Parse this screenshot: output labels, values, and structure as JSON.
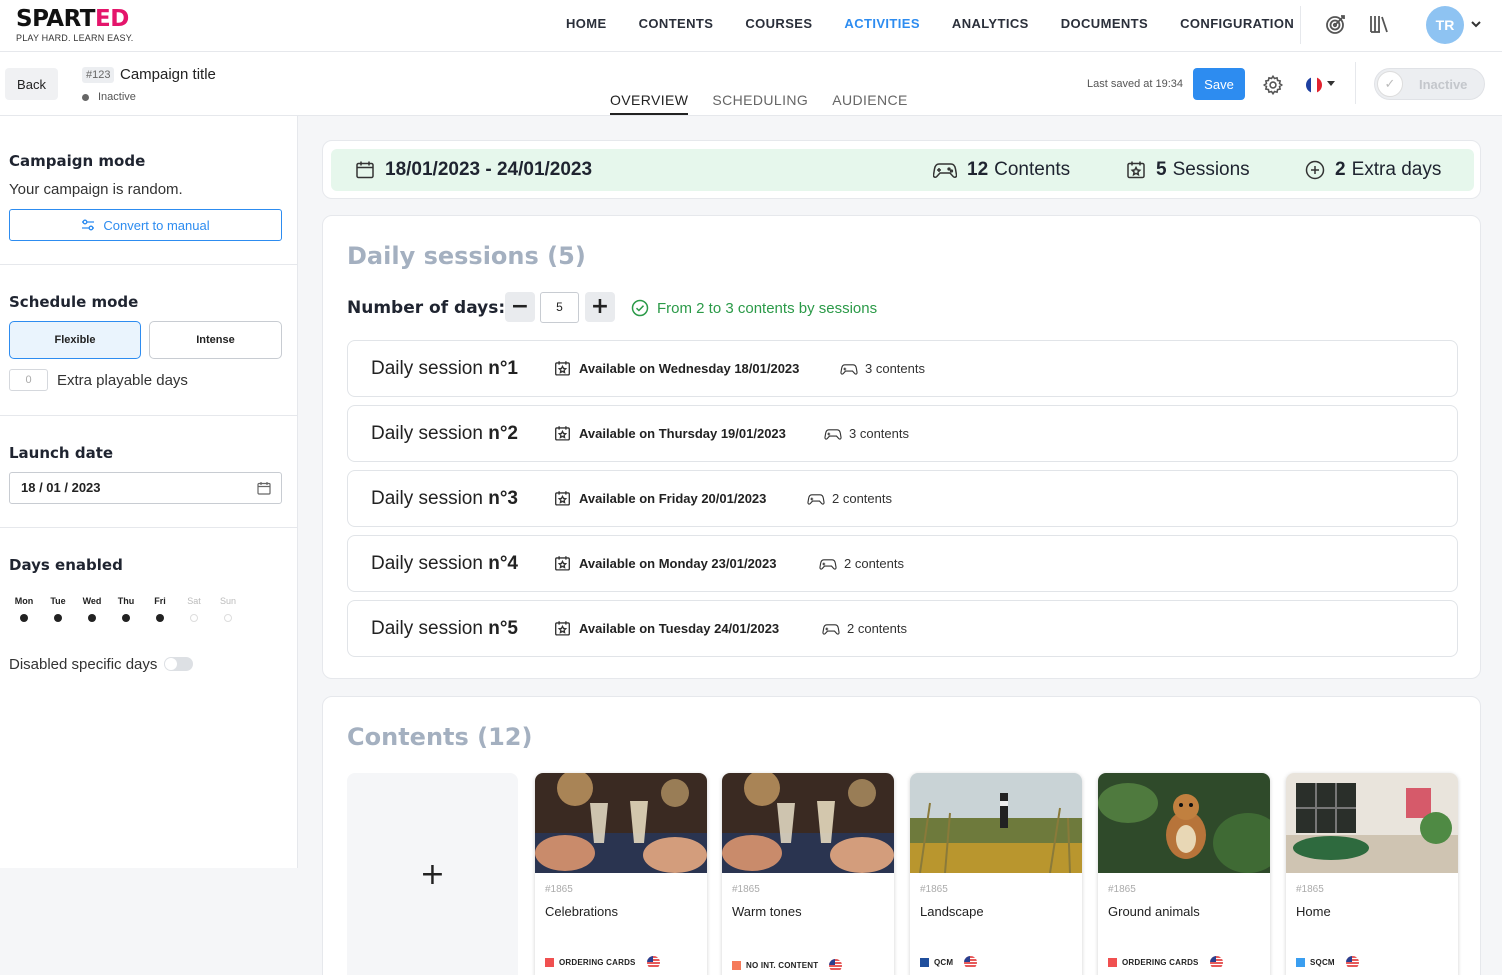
{
  "brand": {
    "name_main": "SPART",
    "name_accent": "ED",
    "tagline": "PLAY HARD. LEARN EASY.",
    "accent_color": "#e4156b"
  },
  "nav": {
    "items": [
      "HOME",
      "CONTENTS",
      "COURSES",
      "ACTIVITIES",
      "ANALYTICS",
      "DOCUMENTS",
      "CONFIGURATION"
    ],
    "active": "ACTIVITIES",
    "icons": [
      "target-icon",
      "library-icon"
    ],
    "avatar_initials": "TR"
  },
  "header": {
    "back_label": "Back",
    "campaign_id": "#123",
    "campaign_title": "Campaign title",
    "status": "Inactive",
    "tabs": [
      "OVERVIEW",
      "SCHEDULING",
      "AUDIENCE"
    ],
    "active_tab": "OVERVIEW",
    "last_saved": "Last saved at 19:34",
    "save_label": "Save",
    "toggle_label": "Inactive",
    "language_flag": "fr"
  },
  "sidebar": {
    "campaign_mode": {
      "title": "Campaign mode",
      "text": "Your campaign is random.",
      "button": "Convert to manual"
    },
    "schedule_mode": {
      "title": "Schedule mode",
      "options": [
        "Flexible",
        "Intense"
      ],
      "selected": "Flexible",
      "extra_days_value": "0",
      "extra_days_label": "Extra playable days"
    },
    "launch_date": {
      "title": "Launch date",
      "value": "18 / 01 / 2023"
    },
    "days_enabled": {
      "title": "Days enabled",
      "days": [
        {
          "name": "Mon",
          "enabled": true
        },
        {
          "name": "Tue",
          "enabled": true
        },
        {
          "name": "Wed",
          "enabled": true
        },
        {
          "name": "Thu",
          "enabled": true
        },
        {
          "name": "Fri",
          "enabled": true
        },
        {
          "name": "Sat",
          "enabled": false
        },
        {
          "name": "Sun",
          "enabled": false
        }
      ],
      "disabled_specific_label": "Disabled specific days"
    }
  },
  "summary": {
    "date_range": "18/01/2023 - 24/01/2023",
    "contents_count": "12",
    "contents_label": "Contents",
    "sessions_count": "5",
    "sessions_label": "Sessions",
    "extra_count": "2",
    "extra_label": "Extra days",
    "bg_color": "#e6f7ec"
  },
  "daily_sessions": {
    "title": "Daily sessions (5)",
    "number_of_days_label": "Number of days:",
    "number_of_days": "5",
    "minus": "−",
    "plus": "+",
    "range_note": "From 2 to 3 contents by sessions",
    "sessions": [
      {
        "name": "Daily session ",
        "num": "n°1",
        "available": "Available on Wednesday 18/01/2023",
        "contents": "3 contents"
      },
      {
        "name": "Daily session ",
        "num": "n°2",
        "available": "Available on Thursday 19/01/2023",
        "contents": "3 contents"
      },
      {
        "name": "Daily session ",
        "num": "n°3",
        "available": "Available on Friday 20/01/2023",
        "contents": "2 contents"
      },
      {
        "name": "Daily session ",
        "num": "n°4",
        "available": "Available on Monday 23/01/2023",
        "contents": "2 contents"
      },
      {
        "name": "Daily session ",
        "num": "n°5",
        "available": "Available on Tuesday 24/01/2023",
        "contents": "2 contents"
      }
    ]
  },
  "contents": {
    "title": "Contents (12)",
    "add_symbol": "+",
    "items": [
      {
        "id": "#1865",
        "name": "Celebrations",
        "type": "ORDERING CARDS",
        "type_color": "#f05050",
        "thumb": "celebration"
      },
      {
        "id": "#1865",
        "name": "Warm tones",
        "type": "NO INT. CONTENT",
        "type_color": "#f57a5a",
        "thumb": "celebration"
      },
      {
        "id": "#1865",
        "name": "Landscape",
        "type": "QCM",
        "type_color": "#1f4e9c",
        "thumb": "landscape"
      },
      {
        "id": "#1865",
        "name": "Ground animals",
        "type": "ORDERING CARDS",
        "type_color": "#f05050",
        "thumb": "animal"
      },
      {
        "id": "#1865",
        "name": "Home",
        "type": "SQCM",
        "type_color": "#3a9ef0",
        "thumb": "home"
      }
    ]
  }
}
